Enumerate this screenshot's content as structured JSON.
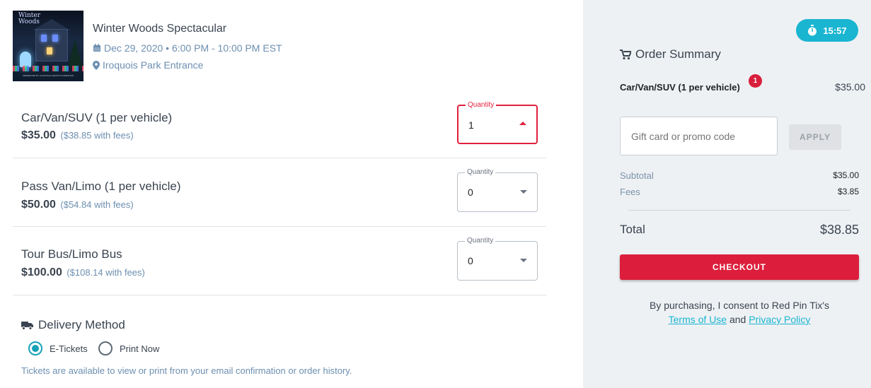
{
  "event": {
    "title": "Winter Woods Spectacular",
    "date": "Dec 29, 2020 • 6:00 PM - 10:00 PM EST",
    "location": "Iroquois Park Entrance",
    "thumb_logo_line1": "Winter",
    "thumb_logo_line2": "Woods",
    "thumb_credit": "PRESENTED BY LOUISVILLE PARKS FOUNDATION"
  },
  "tickets": [
    {
      "name": "Car/Van/SUV (1 per vehicle)",
      "price": "$35.00",
      "fees": "($38.85 with fees)",
      "qty_label": "Quantity",
      "qty": "1"
    },
    {
      "name": "Pass Van/Limo (1 per vehicle)",
      "price": "$50.00",
      "fees": "($54.84 with fees)",
      "qty_label": "Quantity",
      "qty": "0"
    },
    {
      "name": "Tour Bus/Limo Bus",
      "price": "$100.00",
      "fees": "($108.14 with fees)",
      "qty_label": "Quantity",
      "qty": "0"
    }
  ],
  "delivery": {
    "title": "Delivery Method",
    "options": [
      "E-Tickets",
      "Print Now"
    ],
    "selected": "E-Tickets",
    "note": "Tickets are available to view or print from your email confirmation or order history."
  },
  "summary": {
    "timer": "15:57",
    "title": "Order Summary",
    "item_name": "Car/Van/SUV (1 per vehicle)",
    "item_count": "1",
    "item_price": "$35.00",
    "promo_placeholder": "Gift card or promo code",
    "apply_label": "APPLY",
    "subtotal_label": "Subtotal",
    "subtotal": "$35.00",
    "fees_label": "Fees",
    "fees": "$3.85",
    "total_label": "Total",
    "total": "$38.85",
    "checkout_label": "CHECKOUT",
    "consent_text": "By purchasing, I consent to Red Pin Tix's",
    "terms_label": "Terms of Use",
    "and_text": "and",
    "privacy_label": "Privacy Policy"
  },
  "colors": {
    "accent": "#19b5d1",
    "checkout": "#dc1e3c",
    "panel": "#eef1f4"
  }
}
